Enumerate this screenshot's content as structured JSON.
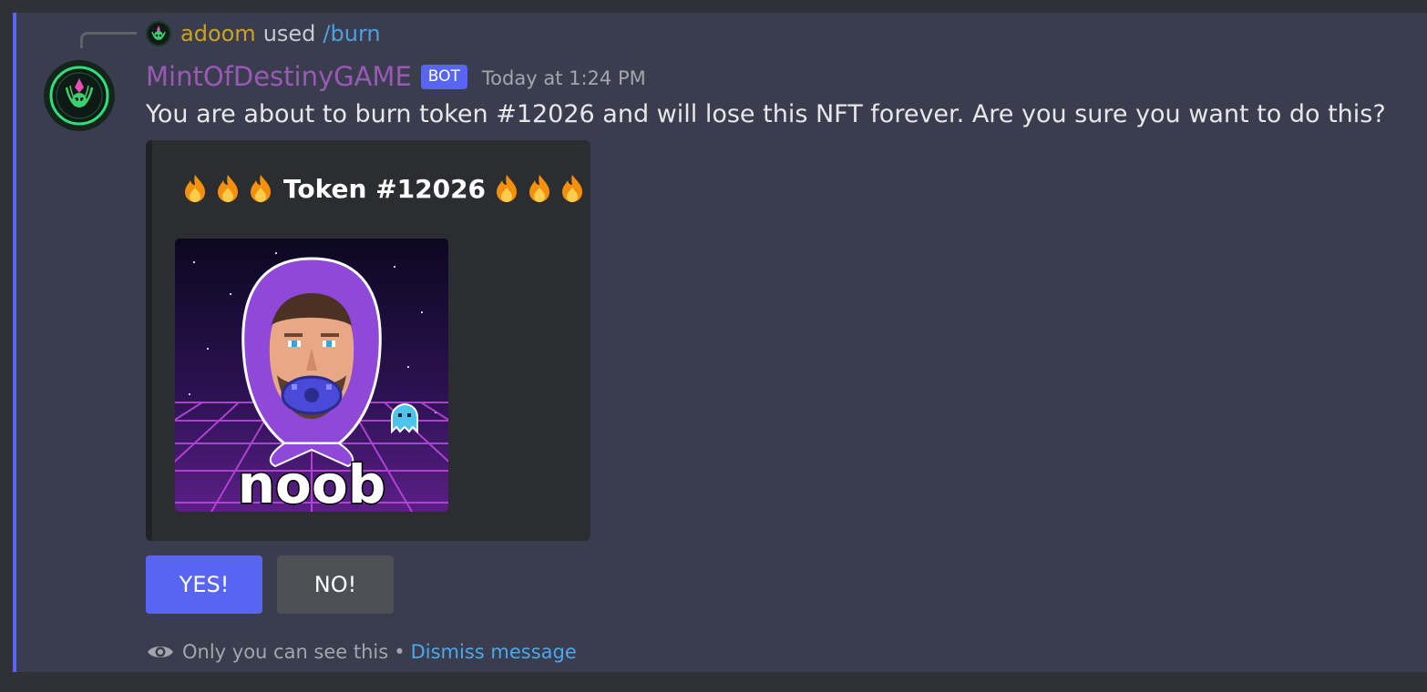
{
  "reply": {
    "user": "adoom",
    "used_text": "used",
    "command": "/burn"
  },
  "message": {
    "author": "MintOfDestinyGAME",
    "bot_tag": "BOT",
    "timestamp": "Today at 1:24 PM",
    "content": "You are about to burn token #12026 and will lose this NFT forever. Are you sure you want to do this?"
  },
  "embed": {
    "title": "Token #12026",
    "image_caption": "noob"
  },
  "buttons": {
    "yes_label": "YES!",
    "no_label": "NO!"
  },
  "footer": {
    "visibility_text": "Only you can see this",
    "separator": "•",
    "dismiss_label": "Dismiss message"
  },
  "colors": {
    "accent": "#5865f2",
    "author": "#9b59b6",
    "reply_user": "#c9a227",
    "link": "#4ea7e8"
  }
}
